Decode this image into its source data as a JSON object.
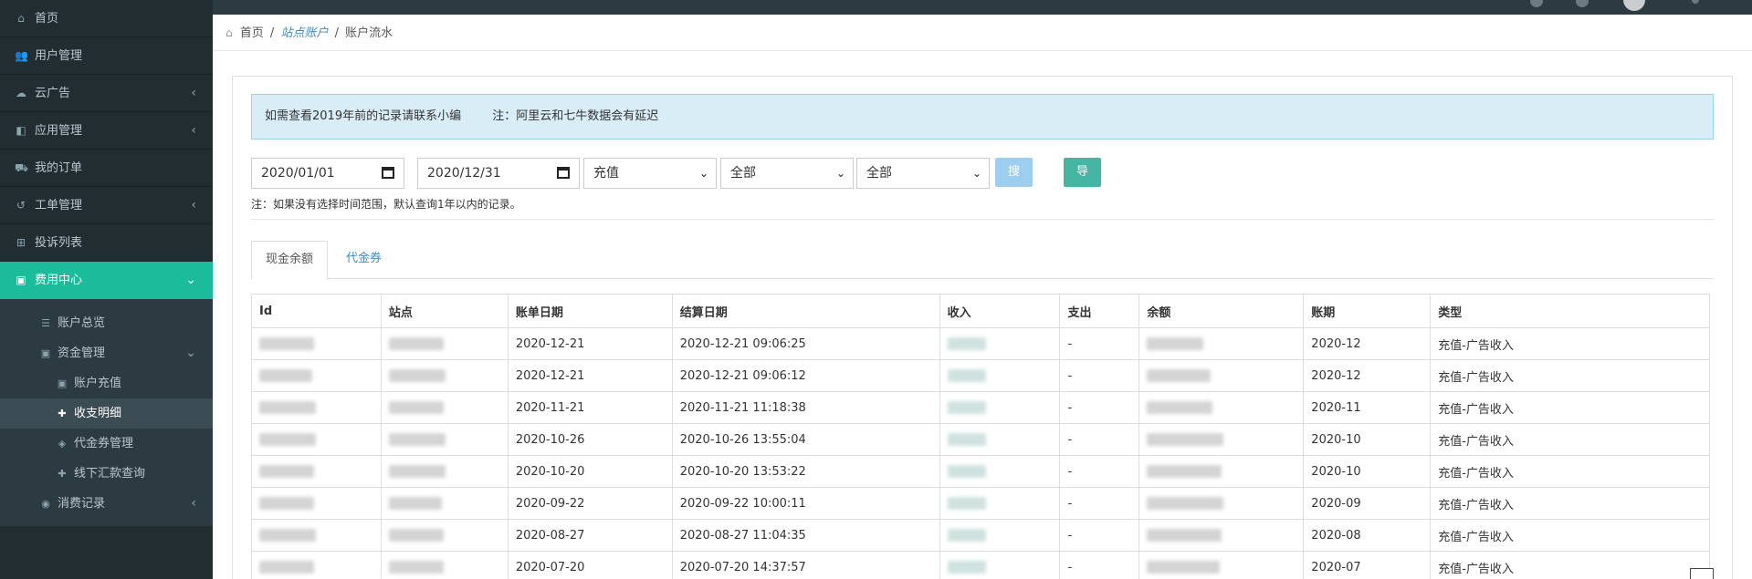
{
  "sidebar": {
    "items": [
      {
        "label": "首页",
        "icon": "home-icon",
        "glyph": "⌂",
        "chevron": false
      },
      {
        "label": "用户管理",
        "icon": "users-icon",
        "glyph": "👥",
        "chevron": false
      },
      {
        "label": "云广告",
        "icon": "cloud-icon",
        "glyph": "☁",
        "chevron": true
      },
      {
        "label": "应用管理",
        "icon": "apps-icon",
        "glyph": "◧",
        "chevron": true
      },
      {
        "label": "我的订单",
        "icon": "cart-icon",
        "glyph": "⛟",
        "chevron": false
      },
      {
        "label": "工单管理",
        "icon": "history-icon",
        "glyph": "↺",
        "chevron": true
      },
      {
        "label": "投诉列表",
        "icon": "plus-square-icon",
        "glyph": "⊞",
        "chevron": false
      },
      {
        "label": "费用中心",
        "icon": "money-icon",
        "glyph": "▣",
        "chevron": true
      }
    ],
    "chevron_glyph": "‹",
    "chevron_open_glyph": "⌄",
    "sub": [
      {
        "label": "账户总览",
        "icon": "list-icon",
        "glyph": "☰",
        "level": 2,
        "chevron": false
      },
      {
        "label": "资金管理",
        "icon": "money-icon",
        "glyph": "▣",
        "level": 2,
        "chevron": true
      },
      {
        "label": "账户充值",
        "icon": "money-icon",
        "glyph": "▣",
        "level": 3,
        "chevron": false
      },
      {
        "label": "收支明细",
        "icon": "plus-icon",
        "glyph": "✚",
        "level": 3,
        "chevron": false
      },
      {
        "label": "代金券管理",
        "icon": "tag-icon",
        "glyph": "◈",
        "level": 3,
        "chevron": false
      },
      {
        "label": "线下汇款查询",
        "icon": "plus-icon",
        "glyph": "✚",
        "level": 3,
        "chevron": false
      },
      {
        "label": "消费记录",
        "icon": "eye-icon",
        "glyph": "◉",
        "level": 2,
        "chevron": true
      }
    ]
  },
  "breadcrumb": {
    "home": "首页",
    "sep": "/",
    "link": "站点账户",
    "current": "账户流水"
  },
  "notice": {
    "line1": "如需查看2019年前的记录请联系小编",
    "line2": "注：阿里云和七牛数据会有延迟"
  },
  "filters": {
    "start_date": "2020/01/01",
    "end_date": "2020/12/31",
    "type": "充值",
    "select2": "全部",
    "select3": "全部",
    "search_label": "搜索",
    "export_label": "导出记录",
    "arrow": "⌄"
  },
  "hint": "注：如果没有选择时间范围，默认查询1年以内的记录。",
  "tabs": {
    "active": "现金余额",
    "other": "代金券"
  },
  "table": {
    "headers": [
      "Id",
      "站点",
      "账单日期",
      "结算日期",
      "收入",
      "支出",
      "余额",
      "账期",
      "类型"
    ],
    "rows": [
      {
        "bill_date": "2020-12-21",
        "settle_date": "2020-12-21 09:06:25",
        "expense": "-",
        "period": "2020-12",
        "type": "充值-广告收入"
      },
      {
        "bill_date": "2020-12-21",
        "settle_date": "2020-12-21 09:06:12",
        "expense": "-",
        "period": "2020-12",
        "type": "充值-广告收入"
      },
      {
        "bill_date": "2020-11-21",
        "settle_date": "2020-11-21 11:18:38",
        "expense": "-",
        "period": "2020-11",
        "type": "充值-广告收入"
      },
      {
        "bill_date": "2020-10-26",
        "settle_date": "2020-10-26 13:55:04",
        "expense": "-",
        "period": "2020-10",
        "type": "充值-广告收入"
      },
      {
        "bill_date": "2020-10-20",
        "settle_date": "2020-10-20 13:53:22",
        "expense": "-",
        "period": "2020-10",
        "type": "充值-广告收入"
      },
      {
        "bill_date": "2020-09-22",
        "settle_date": "2020-09-22 10:00:11",
        "expense": "-",
        "period": "2020-09",
        "type": "充值-广告收入"
      },
      {
        "bill_date": "2020-08-27",
        "settle_date": "2020-08-27 11:04:35",
        "expense": "-",
        "period": "2020-08",
        "type": "充值-广告收入"
      },
      {
        "bill_date": "2020-07-20",
        "settle_date": "2020-07-20 14:37:57",
        "expense": "-",
        "period": "2020-07",
        "type": "充值-广告收入"
      }
    ]
  },
  "colors": {
    "sidebar_bg": "#222d32",
    "active": "#1abc9c",
    "link": "#3c8dbc",
    "notice_bg": "#d9edf7",
    "export_btn": "#45b6a4",
    "search_btn": "#9dcef0"
  }
}
